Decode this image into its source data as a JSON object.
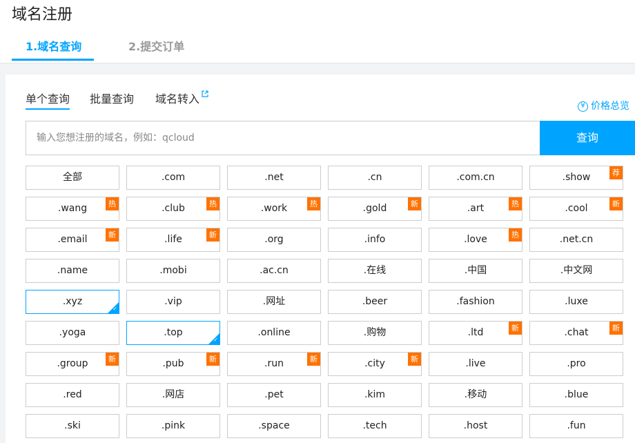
{
  "header": {
    "title": "域名注册",
    "steps": [
      "1.域名查询",
      "2.提交订单"
    ]
  },
  "query_tabs": [
    "单个查询",
    "批量查询",
    "域名转入"
  ],
  "price_link": "价格总览",
  "search": {
    "placeholder": "输入您想注册的域名，例如：qcloud",
    "button": "查询"
  },
  "colors": {
    "accent": "#00a4ff",
    "badge": "#ff7200"
  },
  "badge_labels": {
    "hot": "热",
    "new": "新",
    "recommend": "荐"
  },
  "domains": [
    {
      "label": "全部"
    },
    {
      "label": ".com"
    },
    {
      "label": ".net"
    },
    {
      "label": ".cn"
    },
    {
      "label": ".com.cn"
    },
    {
      "label": ".show",
      "badge": "荐"
    },
    {
      "label": ".wang",
      "badge": "热"
    },
    {
      "label": ".club",
      "badge": "热"
    },
    {
      "label": ".work",
      "badge": "热"
    },
    {
      "label": ".gold",
      "badge": "新"
    },
    {
      "label": ".art",
      "badge": "热"
    },
    {
      "label": ".cool",
      "badge": "新"
    },
    {
      "label": ".email",
      "badge": "新"
    },
    {
      "label": ".life",
      "badge": "新"
    },
    {
      "label": ".org"
    },
    {
      "label": ".info"
    },
    {
      "label": ".love",
      "badge": "热"
    },
    {
      "label": ".net.cn"
    },
    {
      "label": ".name"
    },
    {
      "label": ".mobi"
    },
    {
      "label": ".ac.cn"
    },
    {
      "label": ".在线"
    },
    {
      "label": ".中国"
    },
    {
      "label": ".中文网"
    },
    {
      "label": ".xyz",
      "selected": true
    },
    {
      "label": ".vip"
    },
    {
      "label": ".网址"
    },
    {
      "label": ".beer"
    },
    {
      "label": ".fashion"
    },
    {
      "label": ".luxe"
    },
    {
      "label": ".yoga"
    },
    {
      "label": ".top",
      "selected": true
    },
    {
      "label": ".online"
    },
    {
      "label": ".购物"
    },
    {
      "label": ".ltd",
      "badge": "新"
    },
    {
      "label": ".chat",
      "badge": "新"
    },
    {
      "label": ".group",
      "badge": "新"
    },
    {
      "label": ".pub",
      "badge": "新"
    },
    {
      "label": ".run",
      "badge": "新"
    },
    {
      "label": ".city",
      "badge": "新"
    },
    {
      "label": ".live"
    },
    {
      "label": ".pro"
    },
    {
      "label": ".red"
    },
    {
      "label": ".网店"
    },
    {
      "label": ".pet"
    },
    {
      "label": ".kim"
    },
    {
      "label": ".移动"
    },
    {
      "label": ".blue"
    },
    {
      "label": ".ski"
    },
    {
      "label": ".pink"
    },
    {
      "label": ".space"
    },
    {
      "label": ".tech"
    },
    {
      "label": ".host"
    },
    {
      "label": ".fun"
    }
  ]
}
